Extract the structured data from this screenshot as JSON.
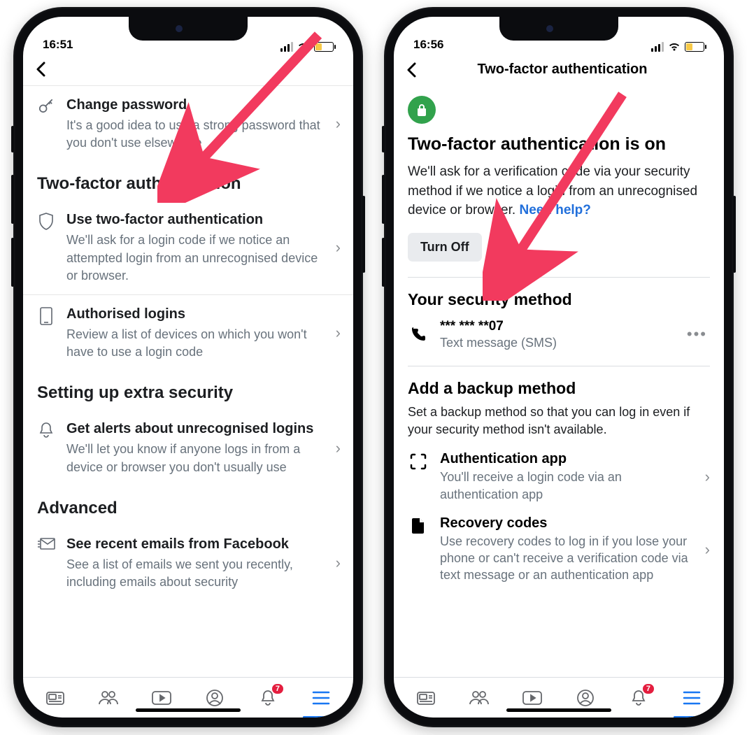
{
  "phone1": {
    "time": "16:51",
    "change_password": {
      "title": "Change password",
      "sub": "It's a good idea to use a strong password that you don't use elsewhere"
    },
    "tfa_section": "Two-factor authentication",
    "use_tfa": {
      "title": "Use two-factor authentication",
      "sub": "We'll ask for a login code if we notice an attempted login from an unrecognised device or browser."
    },
    "auth_logins": {
      "title": "Authorised logins",
      "sub": "Review a list of devices on which you won't have to use a login code"
    },
    "extra_section": "Setting up extra security",
    "alerts": {
      "title": "Get alerts about unrecognised logins",
      "sub": "We'll let you know if anyone logs in from a device or browser you don't usually use"
    },
    "advanced_section": "Advanced",
    "emails": {
      "title": "See recent emails from Facebook",
      "sub": "See a list of emails we sent you recently, including emails about security"
    },
    "tab_badge": "7"
  },
  "phone2": {
    "time": "16:56",
    "header_title": "Two-factor authentication",
    "h2": "Two-factor authentication is on",
    "body": "We'll ask for a verification code via your security method if we notice a login from an unrecognised device or browser. ",
    "need_help": "Need help?",
    "turn_off": "Turn Off",
    "method_section": "Your security method",
    "method": {
      "phone": "*** *** **07",
      "type": "Text message (SMS)"
    },
    "backup_section": "Add a backup method",
    "backup_desc": "Set a backup method so that you can log in even if your security method isn't available.",
    "auth_app": {
      "title": "Authentication app",
      "sub": "You'll receive a login code via an authentication app"
    },
    "recovery": {
      "title": "Recovery codes",
      "sub": "Use recovery codes to log in if you lose your phone or can't receive a verification code via text message or an authentication app"
    },
    "tab_badge": "7"
  },
  "arrows": {
    "color": "#f23a5e"
  }
}
